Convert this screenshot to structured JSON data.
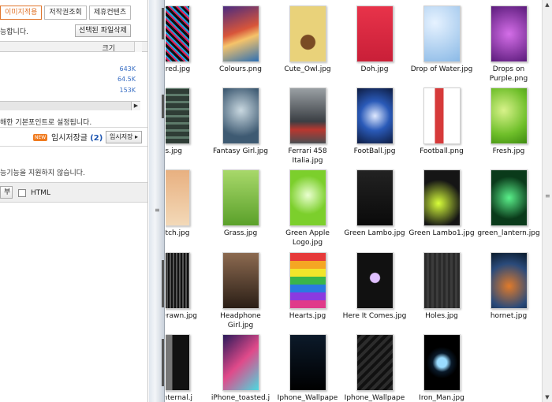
{
  "editor": {
    "tabs": [
      "이미지적용",
      "저작권조회",
      "제휴컨텐츠"
    ],
    "status_line": "능합니다.",
    "delete_selected_button": "선택된 파일삭제",
    "table": {
      "size_header": "크기",
      "sizes": [
        "643K",
        "64.5K",
        "153K"
      ]
    },
    "default_point_notice": "해한 기본포인트로 설정됩니다.",
    "new_badge": "NEW",
    "draft_label": "임시저장글",
    "draft_count": "(2)",
    "draft_save_button": "임시저장 ▸",
    "unsupported_notice": "능기능을 지원하지 않습니다.",
    "cut_button": "부",
    "html_label": "HTML"
  },
  "files": [
    {
      "name": "ured.jpg",
      "cut": true
    },
    {
      "name": "Colours.png"
    },
    {
      "name": "Cute_Owl.jpg"
    },
    {
      "name": "Doh.jpg"
    },
    {
      "name": "Drop of Water.jpg"
    },
    {
      "name": "Drops on Purple.png"
    },
    {
      "name": "es.jpg",
      "cut": true
    },
    {
      "name": "Fantasy Girl.jpg"
    },
    {
      "name": "Ferrari 458 Italia.jpg"
    },
    {
      "name": "FootBall.jpg"
    },
    {
      "name": "Football.png"
    },
    {
      "name": "Fresh.jpg"
    },
    {
      "name": "etch.jpg",
      "cut": true
    },
    {
      "name": "Grass.jpg"
    },
    {
      "name": "Green Apple Logo.jpg"
    },
    {
      "name": "Green Lambo.jpg"
    },
    {
      "name": "Green Lambo1.jpg"
    },
    {
      "name": "green_lantern.jpg"
    },
    {
      "name": "Drawn.jpg",
      "cut": true
    },
    {
      "name": "Headphone Girl.jpg"
    },
    {
      "name": "Hearts.jpg"
    },
    {
      "name": "Here It Comes.jpg"
    },
    {
      "name": "Holes.jpg"
    },
    {
      "name": "hornet.jpg"
    },
    {
      "name": "Internal.j",
      "cut": true
    },
    {
      "name": "iPhone_toasted.j"
    },
    {
      "name": "Iphone_Wallpape"
    },
    {
      "name": "Iphone_Wallpape"
    },
    {
      "name": "Iron_Man.jpg"
    }
  ]
}
